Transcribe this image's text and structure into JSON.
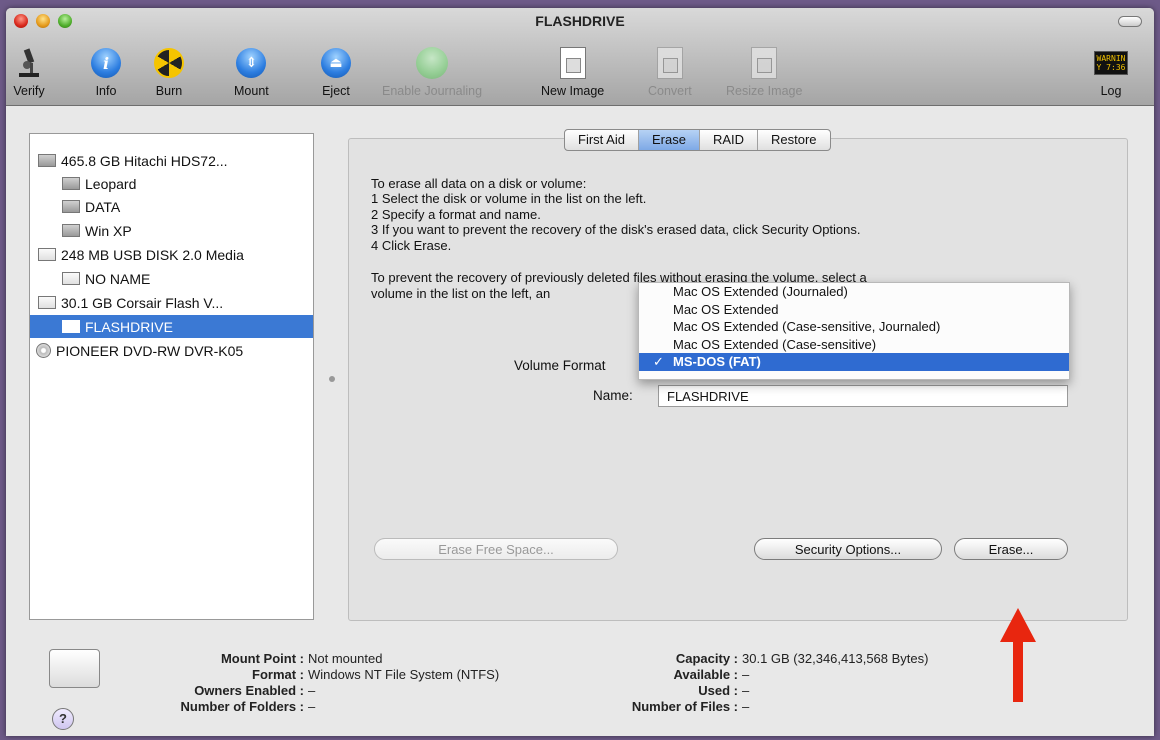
{
  "window": {
    "title": "FLASHDRIVE"
  },
  "toolbar": {
    "items": [
      {
        "label": "Verify",
        "icon": "microscope-icon",
        "enabled": true
      },
      {
        "label": "Info",
        "icon": "info-icon",
        "enabled": true
      },
      {
        "label": "Burn",
        "icon": "burn-icon",
        "enabled": true
      },
      {
        "label": "Mount",
        "icon": "mount-icon",
        "enabled": true
      },
      {
        "label": "Eject",
        "icon": "eject-icon",
        "enabled": true
      },
      {
        "label": "Enable Journaling",
        "icon": "journaling-icon",
        "enabled": false
      },
      {
        "label": "New Image",
        "icon": "new-image-icon",
        "enabled": true
      },
      {
        "label": "Convert",
        "icon": "convert-icon",
        "enabled": false
      },
      {
        "label": "Resize Image",
        "icon": "resize-image-icon",
        "enabled": false
      },
      {
        "label": "Log",
        "icon": "log-icon",
        "enabled": true
      }
    ],
    "log_icon_text": "WARNIN\nY 7:36"
  },
  "sidebar": {
    "items": [
      {
        "label": "465.8 GB Hitachi HDS72...",
        "level": 0,
        "kind": "hd",
        "selected": false
      },
      {
        "label": "Leopard",
        "level": 1,
        "kind": "hd",
        "selected": false
      },
      {
        "label": "DATA",
        "level": 1,
        "kind": "hd",
        "selected": false
      },
      {
        "label": "Win XP",
        "level": 1,
        "kind": "hd",
        "selected": false
      },
      {
        "label": "248 MB USB DISK 2.0 Media",
        "level": 0,
        "kind": "usb",
        "selected": false
      },
      {
        "label": "NO NAME",
        "level": 1,
        "kind": "usb",
        "selected": false
      },
      {
        "label": "30.1 GB Corsair Flash V...",
        "level": 0,
        "kind": "usb",
        "selected": false
      },
      {
        "label": "FLASHDRIVE",
        "level": 1,
        "kind": "usb",
        "selected": true
      },
      {
        "label": "PIONEER DVD-RW DVR-K05",
        "level": 0,
        "kind": "cd",
        "selected": false
      }
    ]
  },
  "tabs": [
    {
      "label": "First Aid",
      "active": false
    },
    {
      "label": "Erase",
      "active": true
    },
    {
      "label": "RAID",
      "active": false
    },
    {
      "label": "Restore",
      "active": false
    }
  ],
  "erase": {
    "instructions": [
      "To erase all data on a disk or volume:",
      "1 Select the disk or volume in the list on the left.",
      "2 Specify a format and name.",
      "3 If you want to prevent the recovery of the disk's erased data, click Security Options.",
      "4 Click Erase."
    ],
    "prevent_line1_a": "To prevent the recovery of previo",
    "prevent_line1_b": "usly deleted files without erasing the volume, select a",
    "prevent_line2": "volume in the list on the left, an",
    "volume_format_label": "Volume Format",
    "name_label": "Name:",
    "name_value": "FLASHDRIVE",
    "format_options": [
      {
        "label": "Mac OS Extended (Journaled)",
        "selected": false
      },
      {
        "label": "Mac OS Extended",
        "selected": false
      },
      {
        "label": "Mac OS Extended (Case-sensitive, Journaled)",
        "selected": false
      },
      {
        "label": "Mac OS Extended (Case-sensitive)",
        "selected": false
      },
      {
        "label": "MS-DOS (FAT)",
        "selected": true
      }
    ],
    "check_mark": "✓",
    "erase_free_space_label": "Erase Free Space...",
    "security_options_label": "Security Options...",
    "erase_label": "Erase..."
  },
  "info": {
    "mount_point_label": "Mount Point :",
    "mount_point_value": "Not mounted",
    "format_label": "Format :",
    "format_value": "Windows NT File System (NTFS)",
    "owners_label": "Owners Enabled :",
    "owners_value": "–",
    "folders_label": "Number of Folders :",
    "folders_value": "–",
    "capacity_label": "Capacity :",
    "capacity_value": "30.1 GB (32,346,413,568 Bytes)",
    "available_label": "Available :",
    "available_value": "–",
    "used_label": "Used :",
    "used_value": "–",
    "files_label": "Number of Files :",
    "files_value": "–"
  },
  "help_label": "?",
  "colors": {
    "selection": "#3b79d4",
    "annotation_arrow": "#e8260f"
  }
}
